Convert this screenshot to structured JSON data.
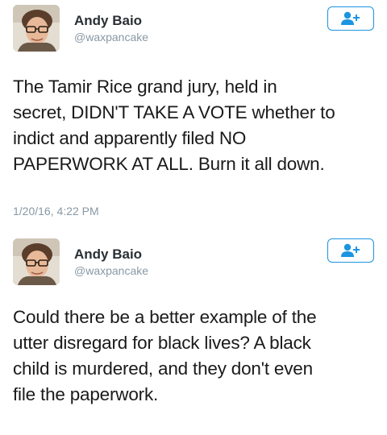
{
  "tweets": [
    {
      "author": {
        "name": "Andy Baio",
        "handle": "@waxpancake"
      },
      "follow_icon": "add-user-icon",
      "text": "The Tamir Rice grand jury, held in\nsecret, DIDN'T TAKE A VOTE whether to\nindict and apparently filed NO\nPAPERWORK AT ALL. Burn it all down.",
      "timestamp": "1/20/16, 4:22 PM"
    },
    {
      "author": {
        "name": "Andy Baio",
        "handle": "@waxpancake"
      },
      "follow_icon": "add-user-icon",
      "text": "Could there be a better example of the\nutter disregard for black lives? A black\nchild is murdered, and they don't even\nfile the paperwork."
    }
  ],
  "colors": {
    "accent": "#1b95e0",
    "secondary_text": "#8899a6",
    "name_text": "#292f33"
  }
}
